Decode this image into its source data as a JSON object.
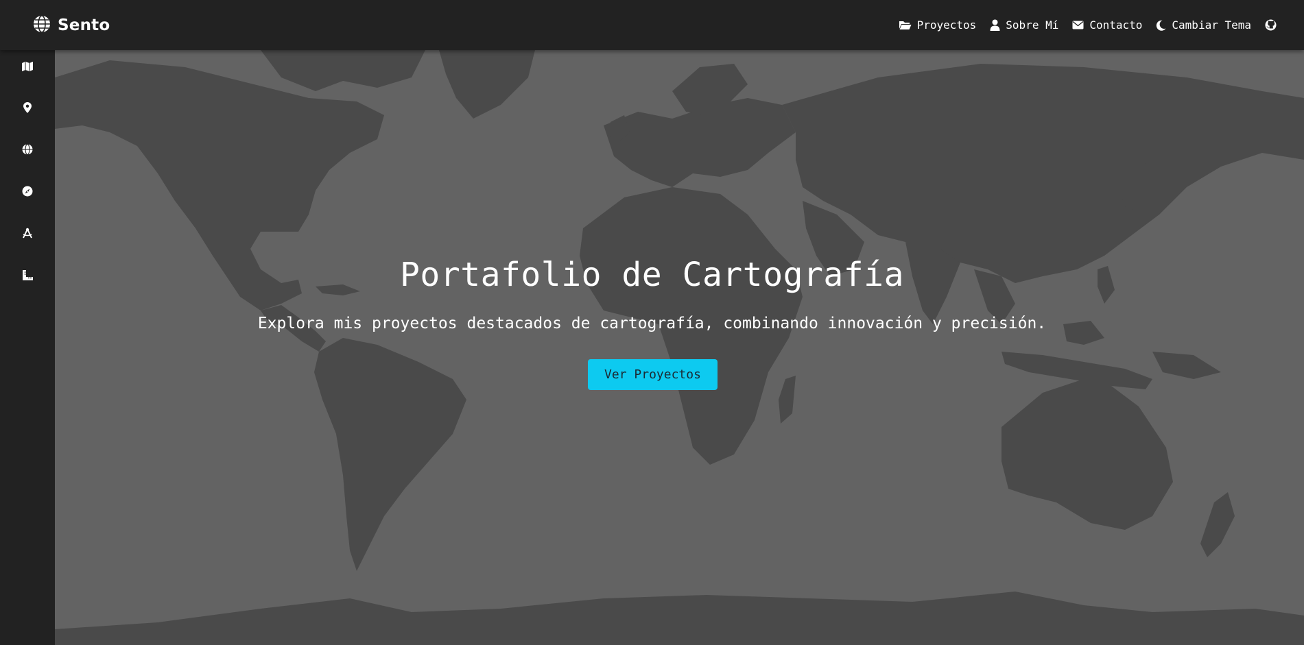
{
  "brand": {
    "name": "Sento",
    "icon": "globe-icon"
  },
  "nav": {
    "items": [
      {
        "label": "Proyectos",
        "icon": "folder-open-icon"
      },
      {
        "label": "Sobre Mí",
        "icon": "user-icon"
      },
      {
        "label": "Contacto",
        "icon": "envelope-icon"
      },
      {
        "label": "Cambiar Tema",
        "icon": "moon-icon"
      },
      {
        "label": "",
        "icon": "github-icon"
      }
    ]
  },
  "sidebar": {
    "items": [
      {
        "icon": "map-icon"
      },
      {
        "icon": "location-pin-icon"
      },
      {
        "icon": "globe-icon"
      },
      {
        "icon": "compass-icon"
      },
      {
        "icon": "drafting-compass-icon"
      },
      {
        "icon": "ruler-icon"
      }
    ]
  },
  "hero": {
    "title": "Portafolio de Cartografía",
    "subtitle": "Explora mis proyectos destacados de cartografía, combinando innovación y precisión.",
    "button_label": "Ver Proyectos"
  },
  "colors": {
    "navbar": "#222222",
    "sidebar": "#222222",
    "map_ocean": "#636363",
    "map_land": "#4a4a4a",
    "accent": "#0dcaf0"
  }
}
